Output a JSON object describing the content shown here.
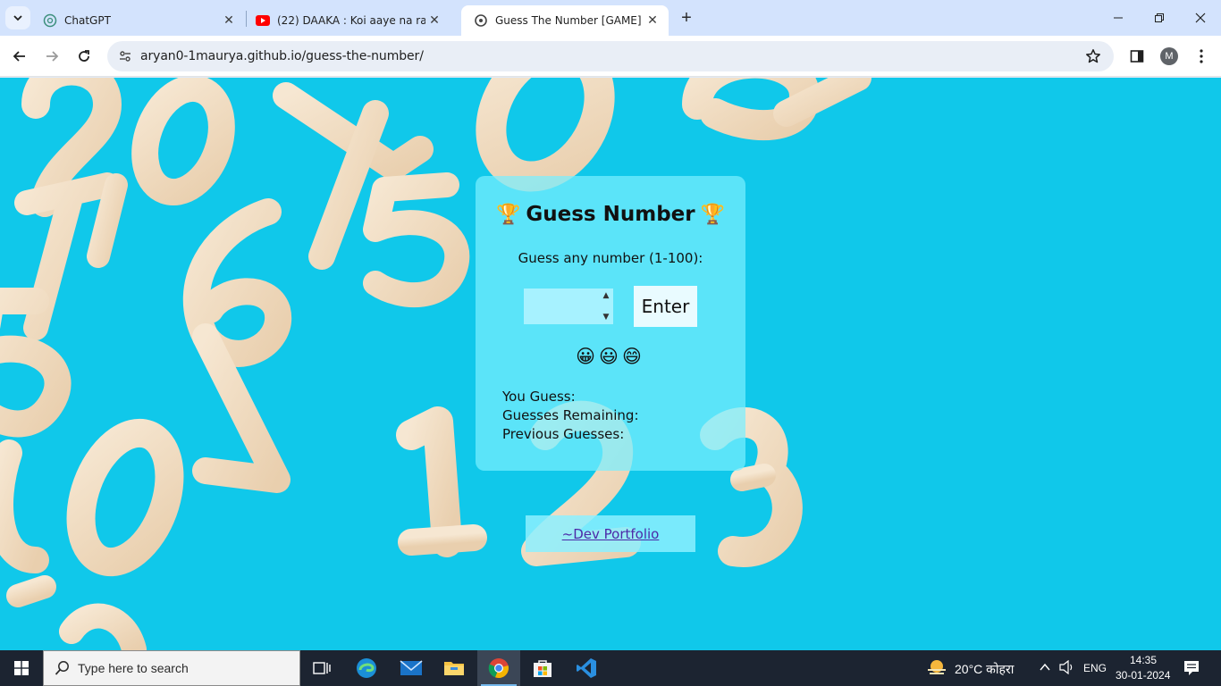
{
  "browser": {
    "tabs": [
      {
        "title": "ChatGPT",
        "active": false,
        "icon": "chatgpt-icon"
      },
      {
        "title": "(22) DAAKA : Koi aaye na rabba",
        "active": false,
        "icon": "youtube-icon"
      },
      {
        "title": "Guess The Number [GAME]",
        "active": true,
        "icon": "globe-icon"
      }
    ],
    "url": "aryan0-1maurya.github.io/guess-the-number/",
    "profile_initial": "M"
  },
  "page": {
    "heading": "Guess Number",
    "trophy": "🏆",
    "instruction": "Guess any number (1-100):",
    "input_value": "",
    "enter_label": "Enter",
    "emojis": "😀😃😄",
    "you_guess_label": "You Guess:",
    "remaining_label": "Guesses Remaining:",
    "previous_label": "Previous Guesses:",
    "portfolio_link": "~Dev Portfolio"
  },
  "taskbar": {
    "search_placeholder": "Type here to search",
    "weather": "20°C कोहरा",
    "language": "ENG",
    "time": "14:35",
    "date": "30-01-2024"
  },
  "colors": {
    "page_bg": "#10c8ea",
    "card_bg": "#78eeff",
    "tab_strip": "#d3e3fd",
    "taskbar": "#1c2431",
    "link": "#4b2aa8"
  }
}
